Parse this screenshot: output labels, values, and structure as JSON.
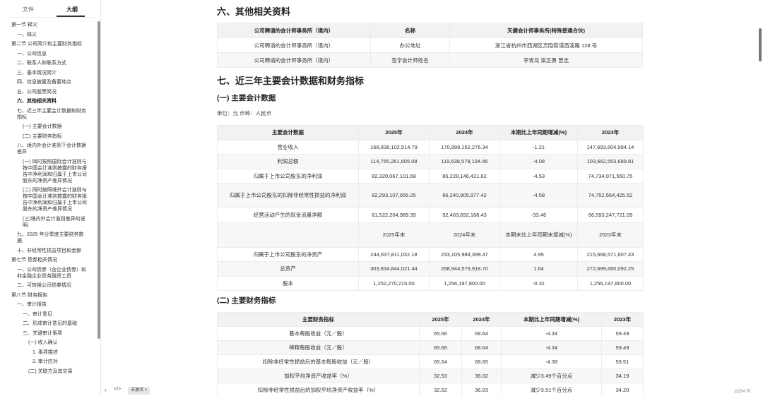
{
  "sidebar": {
    "tab_files": "文件",
    "tab_outline": "大纲",
    "outline": [
      {
        "label": "第一节 释义",
        "level": 0
      },
      {
        "label": "一、释义",
        "level": 1
      },
      {
        "label": "第二节 公司简介和主要财务指标",
        "level": 0
      },
      {
        "label": "一、公司信息",
        "level": 1
      },
      {
        "label": "二、联系人和联系方式",
        "level": 1
      },
      {
        "label": "三、基本情况简介",
        "level": 1
      },
      {
        "label": "四、信息披露及备置地点",
        "level": 1
      },
      {
        "label": "五、公司股票简况",
        "level": 1
      },
      {
        "label": "六、其他相关资料",
        "level": 1,
        "active": true
      },
      {
        "label": "七、近三年主要会计数据和财务指标",
        "level": 1
      },
      {
        "label": "(一) 主要会计数据",
        "level": 2
      },
      {
        "label": "(二) 主要财务指标",
        "level": 2
      },
      {
        "label": "八、境内外会计准则下会计数据差异",
        "level": 1
      },
      {
        "label": "(一) 同时按照国际会计准则与按中国会计准则披露的财务报告中净利润和归属于上市公司股东的净资产差异情况",
        "level": 2
      },
      {
        "label": "(二) 同时按照境外会计准则与按中国会计准则披露的财务报告中净利润和归属于上市公司股东的净资产差异情况",
        "level": 2
      },
      {
        "label": "(三)境内外会计准则差异的说明:",
        "level": 2
      },
      {
        "label": "九、2025 年分季度主要财务数据",
        "level": 1
      },
      {
        "label": "十、非经常性损益项目和金额",
        "level": 1
      },
      {
        "label": "第七节 债券相关情况",
        "level": 0
      },
      {
        "label": "一、公司债券（含企业债券）和非金融企业债务融资工具",
        "level": 1
      },
      {
        "label": "二、可转换公司债券情况",
        "level": 1
      },
      {
        "label": "第八节 财务报告",
        "level": 0
      },
      {
        "label": "一、审计报告",
        "level": 1
      },
      {
        "label": "一、审计意见",
        "level": 2
      },
      {
        "label": "二、形成审计意见的基础",
        "level": 2
      },
      {
        "label": "三、关键审计事项",
        "level": 2
      },
      {
        "label": "(一) 收入确认",
        "level": 3
      },
      {
        "label": "1. 事项描述",
        "level": 4
      },
      {
        "label": "2. 审计应对",
        "level": 4
      },
      {
        "label": "(二) 关联方及其交易",
        "level": 3
      }
    ]
  },
  "bottombar": {
    "prev_icon": "‹",
    "code_icon": "</>",
    "chip": "未激活",
    "chip_close": "×",
    "word_count": "11154 词"
  },
  "main": {
    "section6_title": "六、其他相关资料",
    "cpa_table": {
      "headers": [
        "公司聘请的会计师事务所（境内）",
        "名称",
        "天健会计师事务所(特殊普通合伙)"
      ],
      "rows": [
        [
          "公司聘请的会计师事务所（境内）",
          "办公地址",
          "浙江省杭州市西湖区灵隐街道西溪路 128 号"
        ],
        [
          "公司聘请的会计师事务所（境内）",
          "签字会计师姓名",
          "李青龙 梁正勇 曾志"
        ]
      ]
    },
    "section7_title": "七、近三年主要会计数据和财务指标",
    "sub1_title": "(一) 主要会计数据",
    "unit_line": "单位：元 币种：人民币",
    "acc_table": {
      "headers": [
        "主要会计数据",
        "2025年",
        "2024年",
        "本期比上年同期增减(%)",
        "2023年"
      ],
      "rows": [
        [
          "营业收入",
          "168,838,102,514.79",
          "170,899,152,276.34",
          "-1.21",
          "147,693,604,994.14"
        ],
        [
          "利润总额",
          "114,755,261,605.08",
          "119,638,578,194.46",
          "-4.08",
          "103,662,553,689.81"
        ],
        [
          "归属于上市公司股东的净利润",
          "82,320,067,101.68",
          "86,228,146,421.62",
          "-4.53",
          "74,734,071,550.75"
        ],
        [
          "归属于上市公司股东的扣除非经常性损益的净利润",
          "82,293,107,655.25",
          "86,240,905,977.42",
          "-4.58",
          "74,752,564,425.52"
        ],
        [
          "经营活动产生的现金流量净额",
          "61,522,204,989.35",
          "92,463,692,168.43",
          "-33.46",
          "66,593,247,721.09"
        ],
        [
          "",
          "2025年末",
          "2024年末",
          "本期末比上年同期末增减(%)",
          "2023年末"
        ],
        [
          "归属于上市公司股东的净资产",
          "244,637,811,032.18",
          "233,105,984,399.47",
          "4.95",
          "215,668,571,607.43"
        ],
        [
          "总资产",
          "303,834,844,021.44",
          "298,944,579,918.70",
          "1.64",
          "272,699,660,092.25"
        ],
        [
          "股本",
          "1,252,270,215.00",
          "1,256,197,800.00",
          "-0.31",
          "1,256,197,800.00"
        ]
      ]
    },
    "sub2_title": "(二) 主要财务指标",
    "fin_table": {
      "headers": [
        "主要财务指标",
        "2025年",
        "2024年",
        "本期比上年同期增减(%)",
        "2023年"
      ],
      "rows": [
        [
          "基本每股收益（元／股）",
          "65.66",
          "68.64",
          "-4.34",
          "59.49"
        ],
        [
          "稀释每股收益（元／股）",
          "65.66",
          "68.64",
          "-4.34",
          "59.49"
        ],
        [
          "扣除非经常性损益后的基本每股收益（元／股）",
          "65.64",
          "68.65",
          "-4.38",
          "59.51"
        ],
        [
          "加权平均净资产收益率（%）",
          "32.53",
          "36.02",
          "减少3.49个百分点",
          "34.19"
        ],
        [
          "扣除非经常性损益后的加权平均净资产收益率（%）",
          "32.52",
          "36.03",
          "减少3.51个百分点",
          "34.20"
        ]
      ]
    }
  }
}
